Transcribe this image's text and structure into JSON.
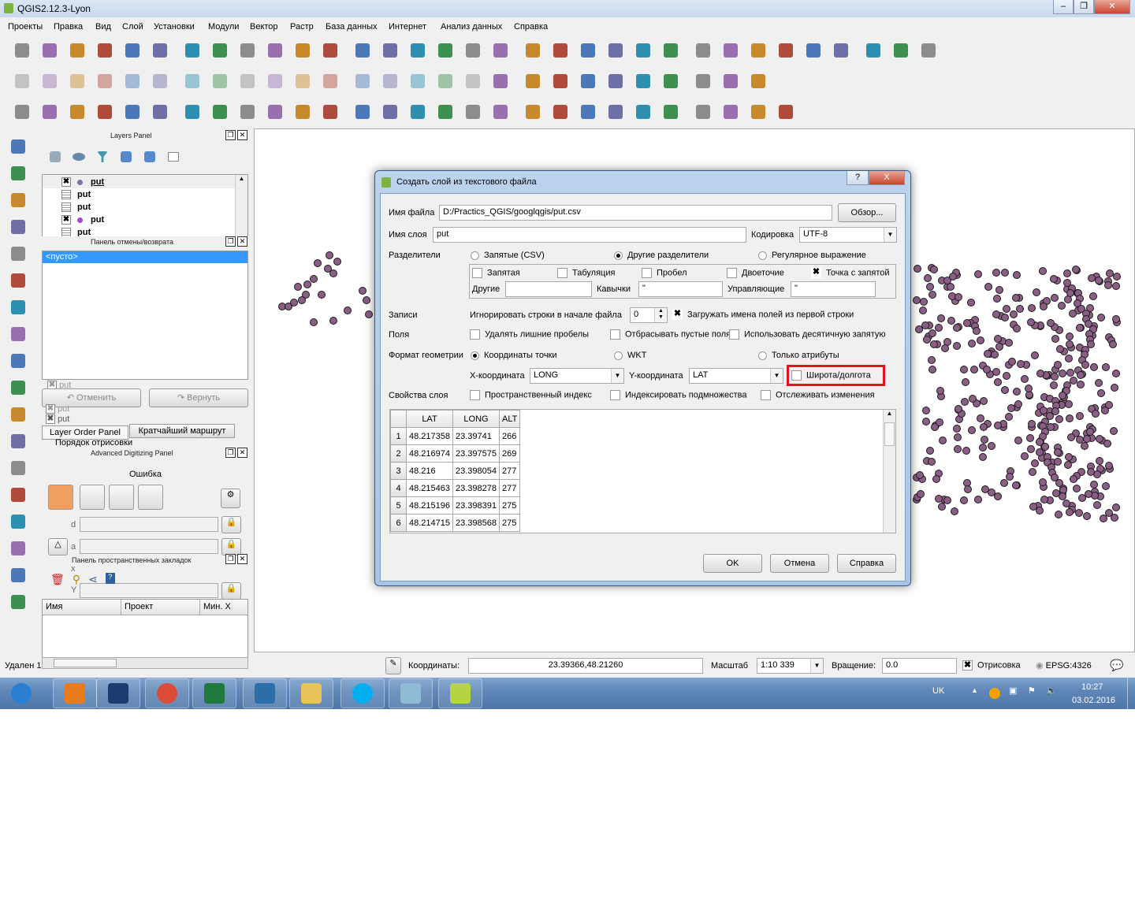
{
  "window": {
    "title": "QGIS2.12.3-Lyon"
  },
  "menu": [
    "Проекты",
    "Правка",
    "Вид",
    "Слой",
    "Установки",
    "Модули",
    "Вектор",
    "Растр",
    "База данных",
    "Интернет",
    "Анализ данных",
    "Справка"
  ],
  "toolbars": {
    "row1": [
      "new-project-icon",
      "open-project-icon",
      "save-project-icon",
      "save-as-icon",
      "new-print-composer-icon",
      "composer-manager-icon",
      "touch-zoom-icon",
      "pan-icon",
      "pan-to-selection-icon",
      "zoom-in-icon",
      "zoom-out-icon",
      "zoom-native-icon",
      "zoom-full-icon",
      "zoom-to-selection-icon",
      "zoom-to-layer-icon",
      "zoom-last-icon",
      "zoom-next-icon",
      "refresh-icon",
      "identify-icon",
      "run-action-icon",
      "select-features-icon",
      "deselect-icon",
      "expression-select-icon",
      "attribute-table-icon",
      "field-calculator-icon",
      "statistics-icon",
      "measure-icon",
      "map-tips-icon",
      "bookmark-icon",
      "new-bookmark-icon",
      "text-annotation-icon",
      "help-icon",
      "whats-this-icon"
    ],
    "row2": [
      "current-edits-icon",
      "toggle-editing-icon",
      "save-edits-icon",
      "add-feature-icon",
      "move-feature-icon",
      "node-tool-icon",
      "delete-selected-icon",
      "cut-features-icon",
      "copy-features-icon",
      "paste-features-icon",
      "label-icon",
      "label-pin-icon",
      "label-show-hide-icon",
      "label-move-icon",
      "label-rotate-icon",
      "label-change-icon",
      "label-extra-icon",
      "osm-icon",
      "shp-icon",
      "raster-icon",
      "download-icon",
      "upload-icon",
      "db-manager-icon",
      "spatialite-icon",
      "csw-icon",
      "python-icon",
      "plugin-icon"
    ],
    "row3": [
      "digitize-icon",
      "undo-icon",
      "redo-icon",
      "simplify-icon",
      "add-ring-icon",
      "add-part-icon",
      "fill-ring-icon",
      "delete-ring-icon",
      "delete-part-icon",
      "reshape-icon",
      "offset-curve-icon",
      "split-features-icon",
      "split-parts-icon",
      "merge-selected-icon",
      "merge-attributes-icon",
      "rotate-symbols-icon",
      "raster-calc-icon",
      "histogram-icon",
      "stretch-icon",
      "local-stretch-icon",
      "brightness-icon",
      "contrast-icon",
      "decrease-icon",
      "increase-icon",
      "grid-icon",
      "point-icon",
      "heatmap-icon",
      "sum-icon"
    ],
    "left": [
      "add-vector-layer-icon",
      "add-raster-layer-icon",
      "add-postgis-layer-icon",
      "add-spatialite-layer-icon",
      "add-mssql-layer-icon",
      "add-oracle-layer-icon",
      "add-db2-layer-icon",
      "add-wms-layer-icon",
      "add-wcs-layer-icon",
      "add-wfs-layer-icon",
      "add-delimited-text-icon",
      "new-vector-layer-icon",
      "new-layer-from-template-icon",
      "crosshair-icon",
      "compass-icon",
      "plugin-b-icon",
      "topology-icon",
      "geometry-checker-icon"
    ]
  },
  "layers_panel": {
    "title": "Layers Panel",
    "layers": [
      {
        "name": "put",
        "checked": true,
        "type": "point",
        "dot_color": "#7777aa",
        "current": true
      },
      {
        "name": "put",
        "checked": false,
        "type": "table"
      },
      {
        "name": "put",
        "checked": false,
        "type": "table"
      },
      {
        "name": "put",
        "checked": true,
        "type": "point",
        "dot_color": "#aa44cc"
      },
      {
        "name": "put",
        "checked": false,
        "type": "table"
      },
      {
        "name": "put",
        "checked": false,
        "type": "table"
      }
    ],
    "hidden_layers": [
      "put",
      "put",
      "put"
    ]
  },
  "undo_panel": {
    "title": "Панель отмены/возврата",
    "empty_item": "<пусто>",
    "undo": "Отменить",
    "redo": "Вернуть"
  },
  "tabs": {
    "layer_order": "Layer Order Panel",
    "shortest_path": "Кратчайший маршрут",
    "render_order": "Порядок отрисовки"
  },
  "adv_digitizing": {
    "title": "Advanced Digitizing Panel",
    "error": "Ошибка",
    "fields": [
      "d",
      "a",
      "x",
      "Y"
    ]
  },
  "bookmarks": {
    "title": "Панель пространственных закладок",
    "columns": [
      "Имя",
      "Проект",
      "Мин. X"
    ]
  },
  "status_left": "Удален 1",
  "dialog": {
    "title": "Создать слой из текстового файла",
    "help_btn": "?",
    "close_btn": "X",
    "file_label": "Имя файла",
    "file_value": "D:/Practics_QGIS/googlqgis/put.csv",
    "browse": "Обзор...",
    "layer_label": "Имя слоя",
    "layer_value": "put",
    "encoding_label": "Кодировка",
    "encoding_value": "UTF-8",
    "delim_label": "Разделители",
    "delim_options": [
      {
        "label": "Запятые (CSV)",
        "on": false
      },
      {
        "label": "Другие разделители",
        "on": true
      },
      {
        "label": "Регулярное выражение",
        "on": false
      }
    ],
    "delim_checks": [
      {
        "label": "Запятая",
        "on": false
      },
      {
        "label": "Табуляция",
        "on": false
      },
      {
        "label": "Пробел",
        "on": false
      },
      {
        "label": "Двоеточие",
        "on": false
      },
      {
        "label": "Точка с запятой",
        "on": true
      }
    ],
    "other_label": "Другие",
    "other_value": "",
    "quote_label": "Кавычки",
    "quote_value": "\"",
    "escape_label": "Управляющие",
    "escape_value": "\"",
    "records_label": "Записи",
    "skip_label": "Игнорировать строки в начале файла",
    "skip_value": "0",
    "header_label": "Загружать имена полей из первой строки",
    "header_on": true,
    "fields_label": "Поля",
    "fields_checks": [
      {
        "label": "Удалять лишние пробелы",
        "on": false
      },
      {
        "label": "Отбрасывать пустые поля",
        "on": false
      },
      {
        "label": "Использовать десятичную запятую",
        "on": false
      }
    ],
    "geom_label": "Формат геометрии",
    "geom_options": [
      {
        "label": "Координаты точки",
        "on": true
      },
      {
        "label": "WKT",
        "on": false
      },
      {
        "label": "Только атрибуты",
        "on": false
      }
    ],
    "x_label": "X-координата",
    "x_value": "LONG",
    "y_label": "Y-координата",
    "y_value": "LAT",
    "dms_label": "Широта/долгота",
    "dms_on": false,
    "highlight_color": "#e0141e",
    "props_label": "Свойства слоя",
    "props_checks": [
      {
        "label": "Пространственный индекс",
        "on": false
      },
      {
        "label": "Индексировать подмножества",
        "on": false
      },
      {
        "label": "Отслеживать изменения",
        "on": false
      }
    ],
    "table": {
      "columns": [
        "LAT",
        "LONG",
        "ALT"
      ],
      "rows": [
        [
          "1",
          "48.217358",
          "23.39741",
          "266"
        ],
        [
          "2",
          "48.216974",
          "23.397575",
          "269"
        ],
        [
          "3",
          "48.216",
          "23.398054",
          "277"
        ],
        [
          "4",
          "48.215463",
          "23.398278",
          "277"
        ],
        [
          "5",
          "48.215196",
          "23.398391",
          "275"
        ],
        [
          "6",
          "48.214715",
          "23.398568",
          "275"
        ]
      ]
    },
    "ok": "OK",
    "cancel": "Отмена",
    "help": "Справка"
  },
  "map": {
    "point_color": "#8b5e85"
  },
  "statusbar": {
    "coords_label": "Координаты:",
    "coords_value": "23.39366,48.21260",
    "scale_label": "Масштаб",
    "scale_value": "1:10 339",
    "rotation_label": "Вращение:",
    "rotation_value": "0.0",
    "render_label": "Отрисовка",
    "render_on": true,
    "crs": "EPSG:4326"
  },
  "taskbar": {
    "apps": [
      "windows-start-icon",
      "media-player-icon",
      "photoshop-icon",
      "chrome-icon",
      "excel-icon",
      "qgis-browser-icon",
      "folder-icon",
      "skype-icon",
      "notepad-icon",
      "qgis-icon"
    ],
    "lang": "UK",
    "time": "10:27",
    "date": "03.02.2016"
  }
}
